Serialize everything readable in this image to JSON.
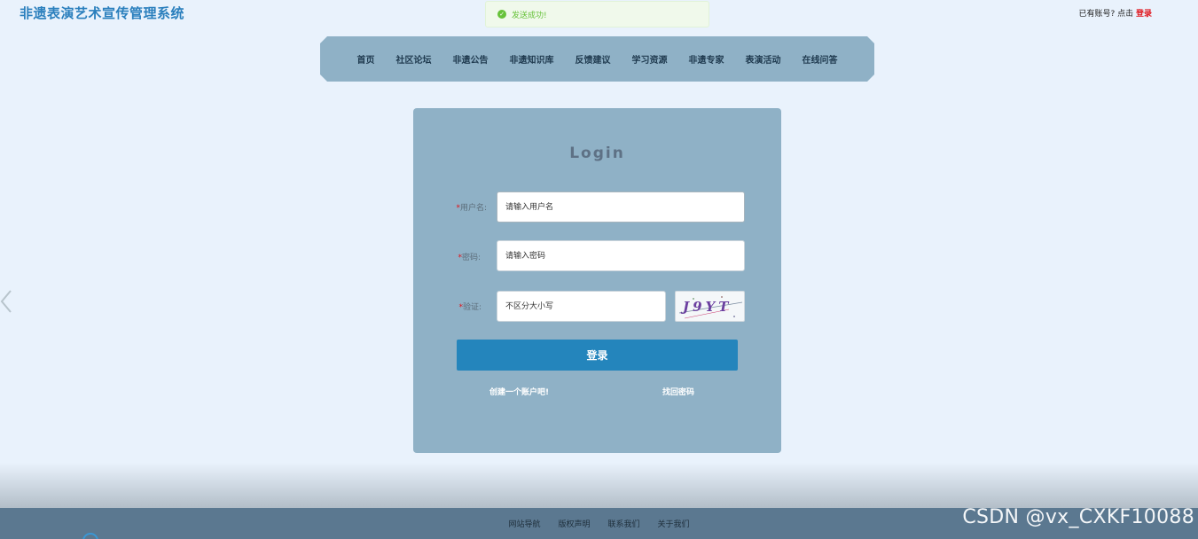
{
  "site": {
    "title": "非遗表演艺术宣传管理系统"
  },
  "toast": {
    "message": "发送成功!"
  },
  "header": {
    "account_hint": "已有账号? 点击",
    "login_link": "登录"
  },
  "nav": {
    "items": [
      {
        "label": "首页"
      },
      {
        "label": "社区论坛"
      },
      {
        "label": "非遗公告"
      },
      {
        "label": "非遗知识库"
      },
      {
        "label": "反馈建议"
      },
      {
        "label": "学习资源"
      },
      {
        "label": "非遗专家"
      },
      {
        "label": "表演活动"
      },
      {
        "label": "在线问答"
      }
    ]
  },
  "login": {
    "title": "Login",
    "username": {
      "label": "用户名",
      "placeholder": "请输入用户名"
    },
    "password": {
      "label": "密码",
      "placeholder": "请输入密码"
    },
    "captcha": {
      "label": "验证",
      "placeholder": "不区分大小写",
      "code": "J9YT"
    },
    "submit_label": "登录",
    "create_account": "创建一个账户吧!",
    "forgot_password": "找回密码"
  },
  "footer": {
    "links": [
      {
        "label": "网站导航"
      },
      {
        "label": "版权声明"
      },
      {
        "label": "联系我们"
      },
      {
        "label": "关于我们"
      }
    ]
  },
  "watermark": "CSDN @vx_CXKF10088",
  "colors": {
    "primary": "#2485bc",
    "nav_bg": "#8fb1c6",
    "page_bg": "#e9f2fc",
    "required": "#e0131a",
    "success": "#67c23a"
  }
}
